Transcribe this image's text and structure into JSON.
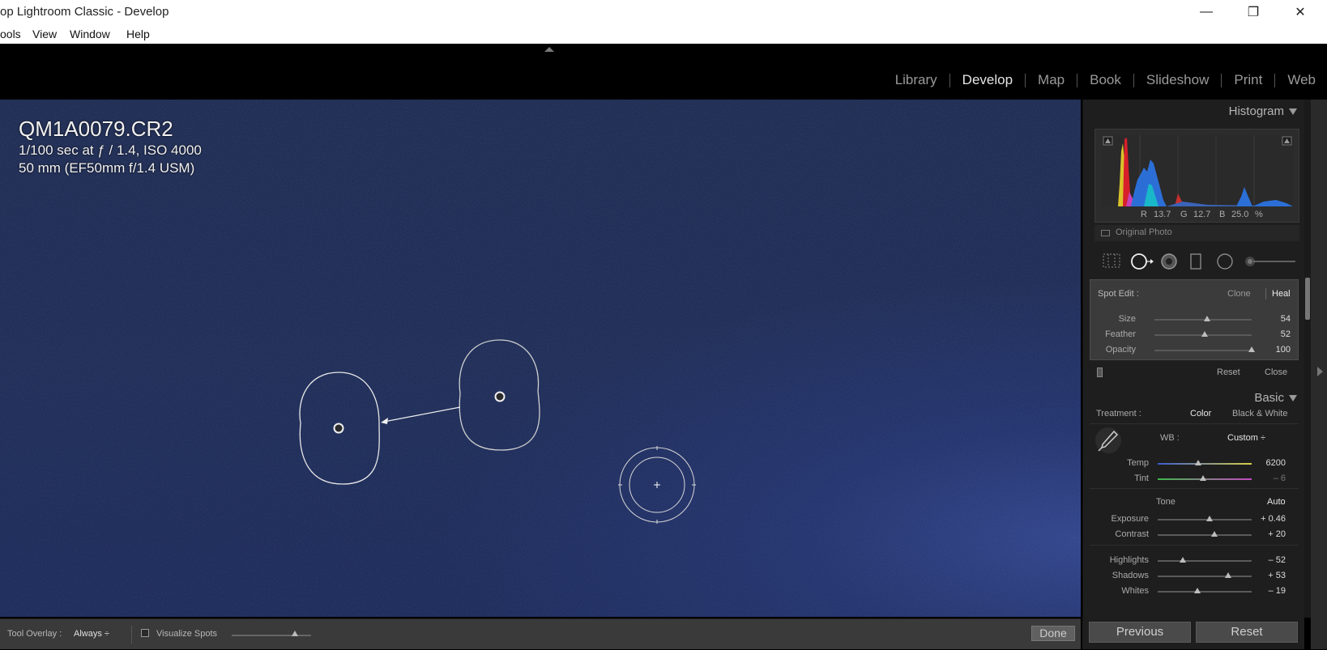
{
  "window": {
    "title": "op Lightroom Classic - Develop",
    "minimize_glyph": "—",
    "restore_glyph": "❐",
    "close_glyph": "✕"
  },
  "menu": [
    "ools",
    "View",
    "Window",
    "Help"
  ],
  "modules": {
    "items": [
      "Library",
      "Develop",
      "Map",
      "Book",
      "Slideshow",
      "Print",
      "Web"
    ],
    "active": "Develop"
  },
  "photo": {
    "filename": "QM1A0079.CR2",
    "exposure_line": "1/100 sec at ƒ / 1.4, ISO 4000",
    "lens_line": "50 mm (EF50mm f/1.4 USM)"
  },
  "toolbar": {
    "tool_overlay_label": "Tool Overlay :",
    "tool_overlay_value": "Always ÷",
    "visualize_spots_label": "Visualize Spots",
    "visualize_spots_level": 0.8,
    "done_label": "Done"
  },
  "histogram": {
    "title": "Histogram",
    "r_label": "R",
    "r_value": "13.7",
    "g_label": "G",
    "g_value": "12.7",
    "b_label": "B",
    "b_value": "25.0",
    "unit": "%",
    "original_photo_label": "Original Photo"
  },
  "spot_edit": {
    "title": "Spot Edit :",
    "clone_label": "Clone",
    "heal_label": "Heal",
    "mode_active": "Heal",
    "sliders": [
      {
        "label": "Size",
        "value": "54",
        "level": 0.54
      },
      {
        "label": "Feather",
        "value": "52",
        "level": 0.52
      },
      {
        "label": "Opacity",
        "value": "100",
        "level": 1.0
      }
    ],
    "reset_label": "Reset",
    "close_label": "Close"
  },
  "basic": {
    "title": "Basic",
    "treatment_label": "Treatment :",
    "color_label": "Color",
    "bw_label": "Black & White",
    "wb_label": "WB :",
    "wb_value": "Custom ÷",
    "wb_sliders": [
      {
        "label": "Temp",
        "value": "6200",
        "level": 0.43
      },
      {
        "label": "Tint",
        "value": "– 6",
        "level": 0.48
      }
    ],
    "tone_label": "Tone",
    "auto_label": "Auto",
    "tone_sliders": [
      {
        "label": "Exposure",
        "value": "+ 0.46",
        "level": 0.55
      },
      {
        "label": "Contrast",
        "value": "+ 20",
        "level": 0.6
      }
    ],
    "presence_sliders": [
      {
        "label": "Highlights",
        "value": "– 52",
        "level": 0.27
      },
      {
        "label": "Shadows",
        "value": "+ 53",
        "level": 0.75
      },
      {
        "label": "Whites",
        "value": "– 19",
        "level": 0.42
      }
    ]
  },
  "buttons": {
    "previous_label": "Previous",
    "reset_label": "Reset"
  },
  "colors": {
    "accent_text": "#e6e6e6",
    "panel_bg": "#1e1e1e",
    "photo_blue": "#17254e"
  }
}
